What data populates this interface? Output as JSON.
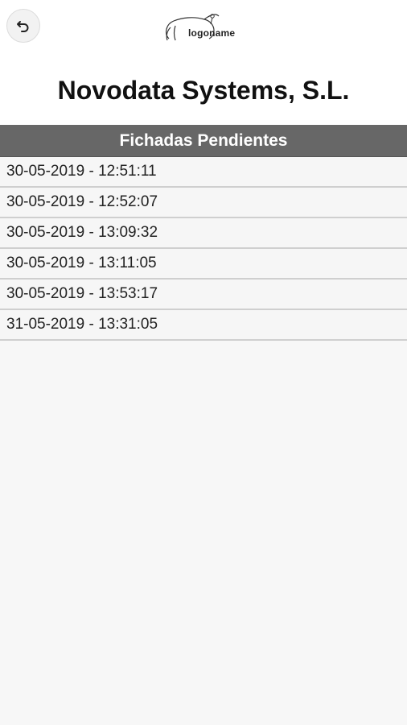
{
  "header": {
    "back_icon": "undo-arrow-icon",
    "logo_text": "logoname",
    "company_name": "Novodata Systems, S.L."
  },
  "list": {
    "title": "Fichadas Pendientes",
    "items": [
      "30-05-2019 - 12:51:11",
      "30-05-2019 - 12:52:07",
      "30-05-2019 - 13:09:32",
      "30-05-2019 - 13:11:05",
      "30-05-2019 - 13:53:17",
      "31-05-2019 - 13:31:05"
    ]
  }
}
